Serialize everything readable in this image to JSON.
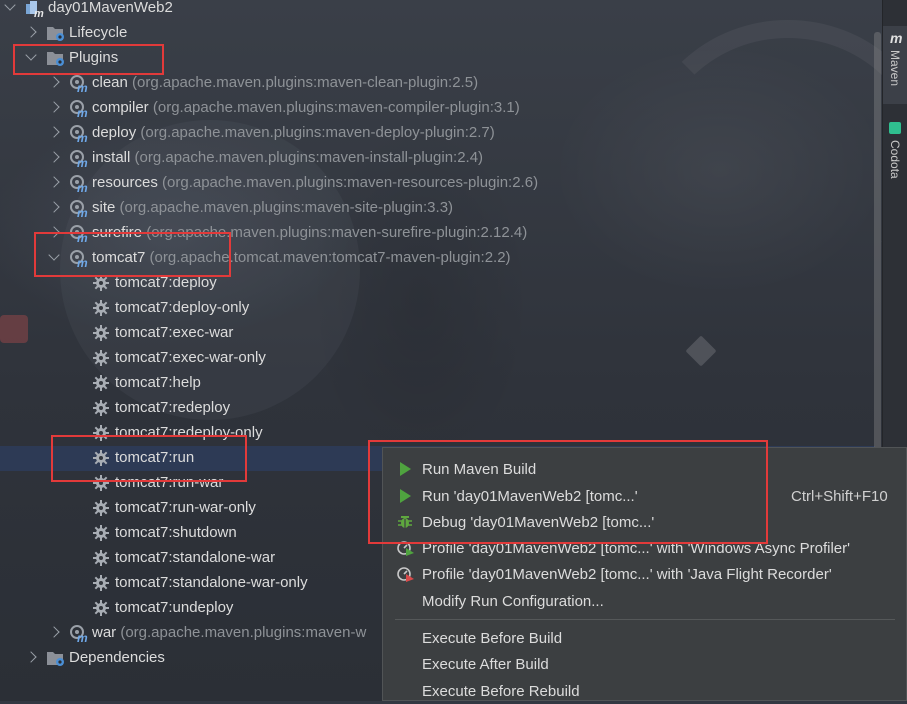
{
  "project": {
    "name": "day01MavenWeb2"
  },
  "tree": {
    "lifecycle": "Lifecycle",
    "plugins": "Plugins",
    "plugin_items": [
      {
        "name": "clean",
        "coords": "(org.apache.maven.plugins:maven-clean-plugin:2.5)"
      },
      {
        "name": "compiler",
        "coords": "(org.apache.maven.plugins:maven-compiler-plugin:3.1)"
      },
      {
        "name": "deploy",
        "coords": "(org.apache.maven.plugins:maven-deploy-plugin:2.7)"
      },
      {
        "name": "install",
        "coords": "(org.apache.maven.plugins:maven-install-plugin:2.4)"
      },
      {
        "name": "resources",
        "coords": "(org.apache.maven.plugins:maven-resources-plugin:2.6)"
      },
      {
        "name": "site",
        "coords": "(org.apache.maven.plugins:maven-site-plugin:3.3)"
      },
      {
        "name": "surefire",
        "coords": "(org.apache.maven.plugins:maven-surefire-plugin:2.12.4)"
      }
    ],
    "tomcat7": {
      "name": "tomcat7",
      "coords": "(org.apache.tomcat.maven:tomcat7-maven-plugin:2.2)"
    },
    "goals": [
      "tomcat7:deploy",
      "tomcat7:deploy-only",
      "tomcat7:exec-war",
      "tomcat7:exec-war-only",
      "tomcat7:help",
      "tomcat7:redeploy",
      "tomcat7:redeploy-only",
      "tomcat7:run",
      "tomcat7:run-war",
      "tomcat7:run-war-only",
      "tomcat7:shutdown",
      "tomcat7:standalone-war",
      "tomcat7:standalone-war-only",
      "tomcat7:undeploy"
    ],
    "war": {
      "name": "war",
      "coords": "(org.apache.maven.plugins:maven-w"
    },
    "dependencies": "Dependencies"
  },
  "sidebar": {
    "maven_tab": "Maven",
    "codota_tab": "Codota",
    "maven_icon_letter": "m"
  },
  "context_menu": {
    "items": [
      {
        "label": "Run Maven Build",
        "shortcut": "",
        "icon": "run-triangle-icon"
      },
      {
        "label": "Run 'day01MavenWeb2 [tomc...'",
        "shortcut": "Ctrl+Shift+F10",
        "icon": "run-triangle-icon"
      },
      {
        "label": "Debug 'day01MavenWeb2 [tomc...'",
        "shortcut": "",
        "icon": "debug-bug-icon"
      },
      {
        "label": "Profile 'day01MavenWeb2 [tomc...' with 'Windows Async Profiler'",
        "shortcut": "",
        "icon": "profile-icon"
      },
      {
        "label": "Profile 'day01MavenWeb2 [tomc...' with 'Java Flight Recorder'",
        "shortcut": "",
        "icon": "profile-record-icon"
      },
      {
        "label": "Modify Run Configuration...",
        "shortcut": "",
        "icon": ""
      },
      {
        "label": "Execute Before Build",
        "shortcut": "",
        "icon": ""
      },
      {
        "label": "Execute After Build",
        "shortcut": "",
        "icon": ""
      },
      {
        "label": "Execute Before Rebuild",
        "shortcut": "",
        "icon": ""
      }
    ]
  },
  "colors": {
    "selection": "#2d3a55",
    "run_green": "#4a9a3a",
    "debug_green": "#5fa83f",
    "highlight_red": "#e23a3a"
  }
}
